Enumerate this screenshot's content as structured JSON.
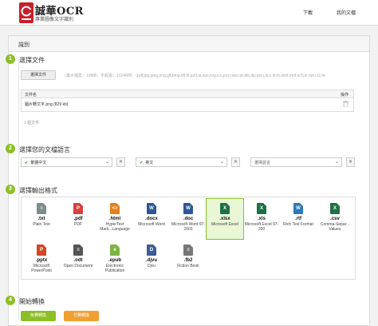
{
  "header": {
    "logo_text": "誠華OCR",
    "logo_sub": "專業圖像文字識別",
    "nav": [
      {
        "label": "下載"
      },
      {
        "label": "我的文檔"
      }
    ]
  },
  "panel": {
    "title": "識別"
  },
  "steps": [
    {
      "num": "1",
      "title": "選擇文件"
    },
    {
      "num": "2",
      "title": "選擇您的文檔語言"
    },
    {
      "num": "3",
      "title": "選擇輸出格式"
    },
    {
      "num": "4",
      "title": "開始轉換"
    }
  ],
  "upload": {
    "button": "選擇文件",
    "hint": "（最大檔案：10MB，不超過：1024MB）（pdf,jpg,jpeg,png,gif,bmp,tiff,tif,psd,ai,eps,svg,ico,pcx,raw,cdr,dib,djv,djvu,dcx,dcm,wmf,emf,xcf,jxr,nef,cr2,heic）",
    "table": {
      "col_file": "文件名",
      "col_action": "操作",
      "rows": [
        {
          "name": "圖片轉文字.png (829 kb)"
        }
      ]
    },
    "count": "1 個文件"
  },
  "languages": {
    "lang1": "繁體中文",
    "lang2": "英文",
    "lang3": "選擇語言"
  },
  "formats": [
    {
      "ext": ".txt",
      "name": "Plain Text",
      "color": "#7f8c8d",
      "selected": false
    },
    {
      "ext": ".pdf",
      "name": "PDF",
      "color": "#d9413b",
      "selected": false
    },
    {
      "ext": ".html",
      "name": "HyperText Mark...Language",
      "color": "#e6801f",
      "selected": false
    },
    {
      "ext": ".docx",
      "name": "Microsoft Word",
      "color": "#2b5797",
      "selected": false
    },
    {
      "ext": ".doc",
      "name": "Microsoft Word 97-2003",
      "color": "#2b5797",
      "selected": false
    },
    {
      "ext": ".xlsx",
      "name": "Microsoft Excel",
      "color": "#1e7145",
      "selected": true
    },
    {
      "ext": ".xls",
      "name": "Microsoft Excel 97-200",
      "color": "#1e7145",
      "selected": false
    },
    {
      "ext": ".rtf",
      "name": "Rich Text Format",
      "color": "#2b7bb9",
      "selected": false
    },
    {
      "ext": ".csv",
      "name": "Comma-Separ... Values",
      "color": "#1e7145",
      "selected": false
    },
    {
      "ext": ".pptx",
      "name": "Microsoft PowerPoint",
      "color": "#d24726",
      "selected": false
    },
    {
      "ext": ".odt",
      "name": "Open Document",
      "color": "#555555",
      "selected": false
    },
    {
      "ext": ".epub",
      "name": "Electronic Publication",
      "color": "#7cb342",
      "selected": false
    },
    {
      "ext": ".djvu",
      "name": "Djvu",
      "color": "#3d5a99",
      "selected": false
    },
    {
      "ext": ".fb2",
      "name": "Fiction Book",
      "color": "#777777",
      "selected": false
    }
  ],
  "actions": {
    "free": "免費轉換",
    "paid": "付費轉換",
    "free_color": "#8cbf26",
    "paid_color": "#f0a030"
  },
  "colors": {
    "accent": "#8cbf26"
  }
}
